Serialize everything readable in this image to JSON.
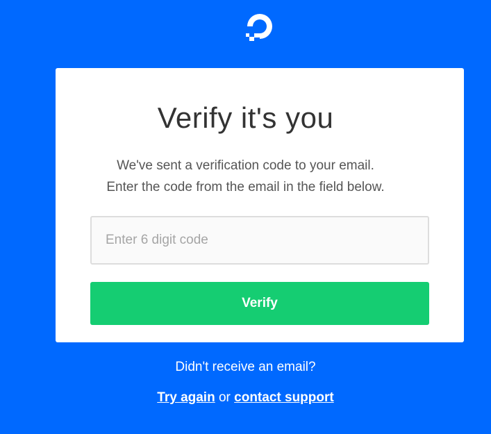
{
  "brand": {
    "logo_icon": "digitalocean-logo-icon",
    "background_color": "#0069ff",
    "accent_color": "#15cd72"
  },
  "card": {
    "title": "Verify it's you",
    "description_line1": "We've sent a verification code to your email.",
    "description_line2": "Enter the code from the email in the field below.",
    "code_input": {
      "value": "",
      "placeholder": "Enter 6 digit code"
    },
    "verify_label": "Verify"
  },
  "footer": {
    "question": "Didn't receive an email?",
    "try_again_label": "Try again",
    "separator": "or",
    "contact_support_label": "contact support"
  }
}
